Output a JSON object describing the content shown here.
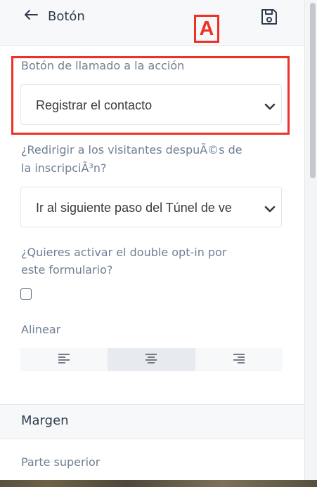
{
  "header": {
    "back_icon": "arrow-left-icon",
    "title": "Botón",
    "save_icon": "save-icon"
  },
  "annotation": {
    "marker_label": "A"
  },
  "cta_field": {
    "label": "Botón de llamado a la acción",
    "value": "Registrar el contacto"
  },
  "redirect_field": {
    "label_line1": "¿Redirigir a los visitantes despuÃ©s de",
    "label_line2": "la inscripciÃ³n?",
    "value": "Ir al siguiente paso del Túnel de ve"
  },
  "double_optin": {
    "label_line1": "¿Quieres activar el double opt-in por",
    "label_line2": "este formulario?",
    "checked": false
  },
  "alignment": {
    "label": "Alinear",
    "options": [
      "align-left-icon",
      "align-center-icon",
      "align-right-icon"
    ],
    "selected": "align-center-icon"
  },
  "margin_section": {
    "title": "Margen",
    "top_label": "Parte superior"
  },
  "colors": {
    "accent_marker": "#ee3124",
    "label_text": "#6e7f93",
    "header_bg": "#f7f8fa"
  }
}
